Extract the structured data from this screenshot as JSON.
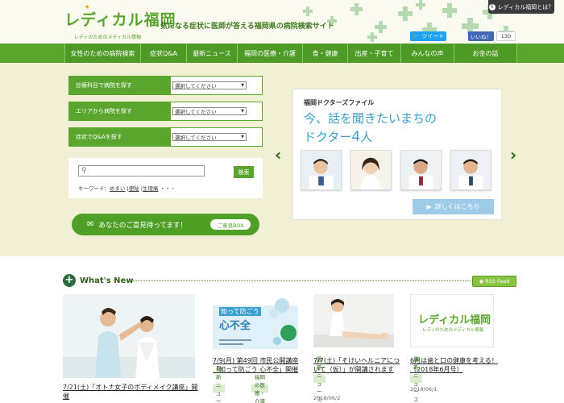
{
  "header": {
    "logo_text": "レディカル福岡",
    "logo_subtitle": "レディのためのメディカル情報",
    "tagline": "気になる症状に医師が答える福岡県の病院検索サイト",
    "about_label": "レディカル福岡とは？",
    "tweet_label": "ツイート",
    "fb_like_label": "いいね！",
    "fb_count": "130"
  },
  "nav": {
    "items": [
      {
        "label": "女性のための病院検索"
      },
      {
        "label": "症状Q&A"
      },
      {
        "label": "最新ニュース"
      },
      {
        "label": "福岡の医療・介護"
      },
      {
        "label": "食・健康"
      },
      {
        "label": "出産・子育て"
      },
      {
        "label": "みんなの声"
      },
      {
        "label": "お金の話"
      }
    ]
  },
  "search": {
    "rows": [
      {
        "label": "診療科目で病院を探す",
        "select": "選択してください"
      },
      {
        "label": "エリアから病院を探す",
        "select": "選択してください"
      },
      {
        "label": "症状でQ&Aを探す",
        "select": "選択してください"
      }
    ],
    "search_button": "検索",
    "keyword_prefix": "キーワード：",
    "keywords": [
      "めまい",
      "便秘",
      "生理痛"
    ],
    "keywords_more": "・・・"
  },
  "opinion": {
    "label": "あなたのご意見待ってます！",
    "pill": "ご意見BOX"
  },
  "doctor_card": {
    "kicker": "福岡ドクターズファイル",
    "title_line1": "今、話を聞きたいまちの",
    "title_line2_prefix": "ドクター",
    "title_line2_num": "4",
    "title_line2_suffix": "人",
    "details": "詳しくはこちら"
  },
  "whats_new": {
    "title": "What's New",
    "rss": "RSS Feed",
    "items": [
      {
        "title": "7/21(土)「オトナ女子のボディメイク講座」開催"
      },
      {
        "title": "7/9(月) 第49回 市民公開講座「知って防ごう 心不全」開催",
        "tags": [
          "最新ニュース",
          "福岡の医療・介護"
        ],
        "img_l1": "知って防ごう",
        "img_l2": "心不全"
      },
      {
        "title": "7/7(土)「そけいヘルニアについて（仮）」が開講されます",
        "tag": "最新ニュース",
        "date": "2018/06/2"
      },
      {
        "title": "6月は歯と口の健康を考える！（2018年6月号）",
        "tag": "最新ニュース",
        "date": "2018/06/1"
      }
    ]
  },
  "colors": {
    "brand_green": "#5aa52e",
    "accent_blue": "#3ea1c7"
  }
}
